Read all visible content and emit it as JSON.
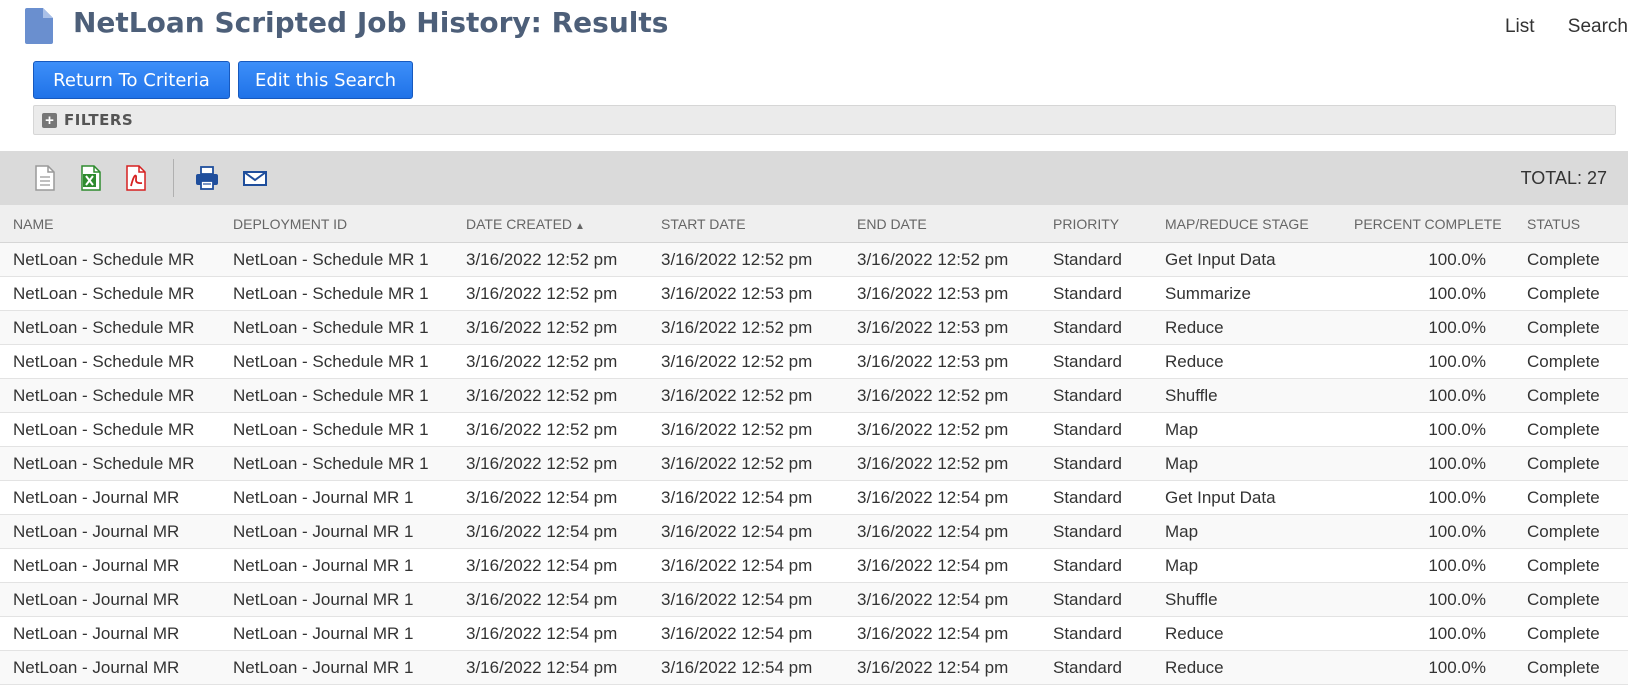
{
  "header": {
    "title": "NetLoan Scripted Job History: Results",
    "links": [
      "List",
      "Search"
    ]
  },
  "buttons": {
    "return_label": "Return To Criteria",
    "edit_label": "Edit this Search"
  },
  "filters": {
    "label": "FILTERS"
  },
  "toolbar": {
    "icons": [
      "export-csv-icon",
      "export-excel-icon",
      "export-pdf-icon",
      "print-icon",
      "email-icon"
    ],
    "total_label": "TOTAL: 27"
  },
  "colors": {
    "button": "#2b7ff2",
    "title": "#4d5f79",
    "toolbar": "#dadada"
  },
  "table": {
    "columns": [
      "Name",
      "Deployment ID",
      "Date Created",
      "Start Date",
      "End Date",
      "Priority",
      "Map/Reduce Stage",
      "Percent Complete",
      "Status"
    ],
    "sorted_column": "Date Created",
    "sort_direction": "ascending",
    "rows": [
      [
        "NetLoan - Schedule MR",
        "NetLoan - Schedule MR 1",
        "3/16/2022 12:52 pm",
        "3/16/2022 12:52 pm",
        "3/16/2022 12:52 pm",
        "Standard",
        "Get Input Data",
        "100.0%",
        "Complete"
      ],
      [
        "NetLoan - Schedule MR",
        "NetLoan - Schedule MR 1",
        "3/16/2022 12:52 pm",
        "3/16/2022 12:53 pm",
        "3/16/2022 12:53 pm",
        "Standard",
        "Summarize",
        "100.0%",
        "Complete"
      ],
      [
        "NetLoan - Schedule MR",
        "NetLoan - Schedule MR 1",
        "3/16/2022 12:52 pm",
        "3/16/2022 12:52 pm",
        "3/16/2022 12:53 pm",
        "Standard",
        "Reduce",
        "100.0%",
        "Complete"
      ],
      [
        "NetLoan - Schedule MR",
        "NetLoan - Schedule MR 1",
        "3/16/2022 12:52 pm",
        "3/16/2022 12:52 pm",
        "3/16/2022 12:53 pm",
        "Standard",
        "Reduce",
        "100.0%",
        "Complete"
      ],
      [
        "NetLoan - Schedule MR",
        "NetLoan - Schedule MR 1",
        "3/16/2022 12:52 pm",
        "3/16/2022 12:52 pm",
        "3/16/2022 12:52 pm",
        "Standard",
        "Shuffle",
        "100.0%",
        "Complete"
      ],
      [
        "NetLoan - Schedule MR",
        "NetLoan - Schedule MR 1",
        "3/16/2022 12:52 pm",
        "3/16/2022 12:52 pm",
        "3/16/2022 12:52 pm",
        "Standard",
        "Map",
        "100.0%",
        "Complete"
      ],
      [
        "NetLoan - Schedule MR",
        "NetLoan - Schedule MR 1",
        "3/16/2022 12:52 pm",
        "3/16/2022 12:52 pm",
        "3/16/2022 12:52 pm",
        "Standard",
        "Map",
        "100.0%",
        "Complete"
      ],
      [
        "NetLoan - Journal MR",
        "NetLoan - Journal MR 1",
        "3/16/2022 12:54 pm",
        "3/16/2022 12:54 pm",
        "3/16/2022 12:54 pm",
        "Standard",
        "Get Input Data",
        "100.0%",
        "Complete"
      ],
      [
        "NetLoan - Journal MR",
        "NetLoan - Journal MR 1",
        "3/16/2022 12:54 pm",
        "3/16/2022 12:54 pm",
        "3/16/2022 12:54 pm",
        "Standard",
        "Map",
        "100.0%",
        "Complete"
      ],
      [
        "NetLoan - Journal MR",
        "NetLoan - Journal MR 1",
        "3/16/2022 12:54 pm",
        "3/16/2022 12:54 pm",
        "3/16/2022 12:54 pm",
        "Standard",
        "Map",
        "100.0%",
        "Complete"
      ],
      [
        "NetLoan - Journal MR",
        "NetLoan - Journal MR 1",
        "3/16/2022 12:54 pm",
        "3/16/2022 12:54 pm",
        "3/16/2022 12:54 pm",
        "Standard",
        "Shuffle",
        "100.0%",
        "Complete"
      ],
      [
        "NetLoan - Journal MR",
        "NetLoan - Journal MR 1",
        "3/16/2022 12:54 pm",
        "3/16/2022 12:54 pm",
        "3/16/2022 12:54 pm",
        "Standard",
        "Reduce",
        "100.0%",
        "Complete"
      ],
      [
        "NetLoan - Journal MR",
        "NetLoan - Journal MR 1",
        "3/16/2022 12:54 pm",
        "3/16/2022 12:54 pm",
        "3/16/2022 12:54 pm",
        "Standard",
        "Reduce",
        "100.0%",
        "Complete"
      ]
    ]
  }
}
